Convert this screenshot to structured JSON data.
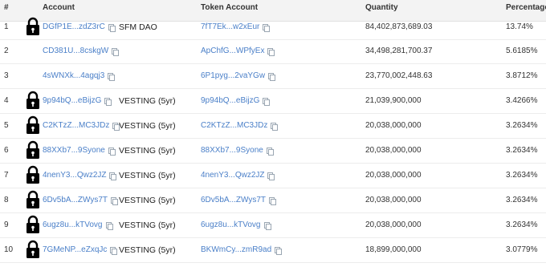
{
  "columns": {
    "num": "#",
    "account": "Account",
    "token_account": "Token Account",
    "quantity": "Quantity",
    "percentage": "Percentage"
  },
  "rows": [
    {
      "rank": "1",
      "locked": true,
      "account": "DGfP1E...zdZ3rC",
      "label": "SFM DAO",
      "token_account": "7fT7Ek...w2xEur",
      "quantity": "84,402,873,689.03",
      "percentage": "13.74%"
    },
    {
      "rank": "2",
      "locked": false,
      "account": "CD381U...8cskgW",
      "label": "",
      "token_account": "ApChfG...WPfyEx",
      "quantity": "34,498,281,700.37",
      "percentage": "5.6185%"
    },
    {
      "rank": "3",
      "locked": false,
      "account": "4sWNXk...4agqj3",
      "label": "",
      "token_account": "6P1pyg...2vaYGw",
      "quantity": "23,770,002,448.63",
      "percentage": "3.8712%"
    },
    {
      "rank": "4",
      "locked": true,
      "account": "9p94bQ...eBijzG",
      "label": "VESTING (5yr)",
      "token_account": "9p94bQ...eBijzG",
      "quantity": "21,039,900,000",
      "percentage": "3.4266%"
    },
    {
      "rank": "5",
      "locked": true,
      "account": "C2KTzZ...MC3JDz",
      "label": "VESTING (5yr)",
      "token_account": "C2KTzZ...MC3JDz",
      "quantity": "20,038,000,000",
      "percentage": "3.2634%"
    },
    {
      "rank": "6",
      "locked": true,
      "account": "88XXb7...9Syone",
      "label": "VESTING (5yr)",
      "token_account": "88XXb7...9Syone",
      "quantity": "20,038,000,000",
      "percentage": "3.2634%"
    },
    {
      "rank": "7",
      "locked": true,
      "account": "4nenY3...Qwz2JZ",
      "label": "VESTING (5yr)",
      "token_account": "4nenY3...Qwz2JZ",
      "quantity": "20,038,000,000",
      "percentage": "3.2634%"
    },
    {
      "rank": "8",
      "locked": true,
      "account": "6Dv5bA...ZWys7T",
      "label": "VESTING (5yr)",
      "token_account": "6Dv5bA...ZWys7T",
      "quantity": "20,038,000,000",
      "percentage": "3.2634%"
    },
    {
      "rank": "9",
      "locked": true,
      "account": "6ugz8u...kTVovg",
      "label": "VESTING (5yr)",
      "token_account": "6ugz8u...kTVovg",
      "quantity": "20,038,000,000",
      "percentage": "3.2634%"
    },
    {
      "rank": "10",
      "locked": true,
      "account": "7GMeNP...eZxqJc",
      "label": "VESTING (5yr)",
      "token_account": "BKWmCy...zmR9ad",
      "quantity": "18,899,000,000",
      "percentage": "3.0779%"
    }
  ],
  "colors": {
    "link": "#4a7fc8",
    "header_bg": "#f3f3f3"
  },
  "icons": {
    "lock": "padlock-icon",
    "copy": "copy-icon"
  }
}
